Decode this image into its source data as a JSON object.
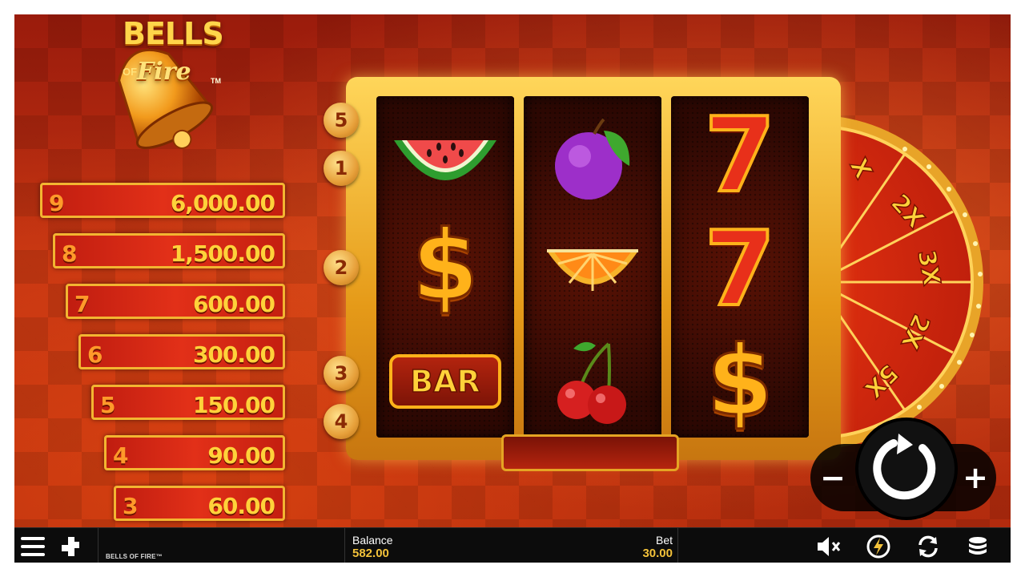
{
  "game": {
    "logo_line1": "BELLS",
    "logo_of": "OF",
    "logo_line2": "Fire",
    "logo_tm": "TM",
    "footer_name": "BELLS OF FIRE™"
  },
  "paytable": [
    {
      "count": "9",
      "value": "6,000.00"
    },
    {
      "count": "8",
      "value": "1,500.00"
    },
    {
      "count": "7",
      "value": "600.00"
    },
    {
      "count": "6",
      "value": "300.00"
    },
    {
      "count": "5",
      "value": "150.00"
    },
    {
      "count": "4",
      "value": "90.00"
    },
    {
      "count": "3",
      "value": "60.00"
    }
  ],
  "paylines": [
    "5",
    "1",
    "2",
    "3",
    "4"
  ],
  "reels": [
    [
      "watermelon",
      "dollar",
      "bar"
    ],
    [
      "plum",
      "orange",
      "cherry"
    ],
    [
      "seven",
      "seven",
      "dollar"
    ]
  ],
  "bar_symbol_text": "BAR",
  "seven_symbol_text": "7",
  "dollar_symbol_text": "$",
  "wheel_multipliers": [
    "X",
    "2X",
    "3X",
    "2X",
    "5X"
  ],
  "controls": {
    "minus": "−",
    "plus": "+"
  },
  "bottom_bar": {
    "balance_label": "Balance",
    "balance_value": "582.00",
    "bet_label": "Bet",
    "bet_value": "30.00"
  },
  "icons": [
    "menu-icon",
    "puzzle-icon",
    "spin-icon",
    "mute-icon",
    "turbo-icon",
    "autoplay-icon",
    "coins-icon"
  ],
  "colors": {
    "accent_gold": "#f3c23a",
    "frame_gold": "#e59a18",
    "background_red": "#c23312"
  }
}
